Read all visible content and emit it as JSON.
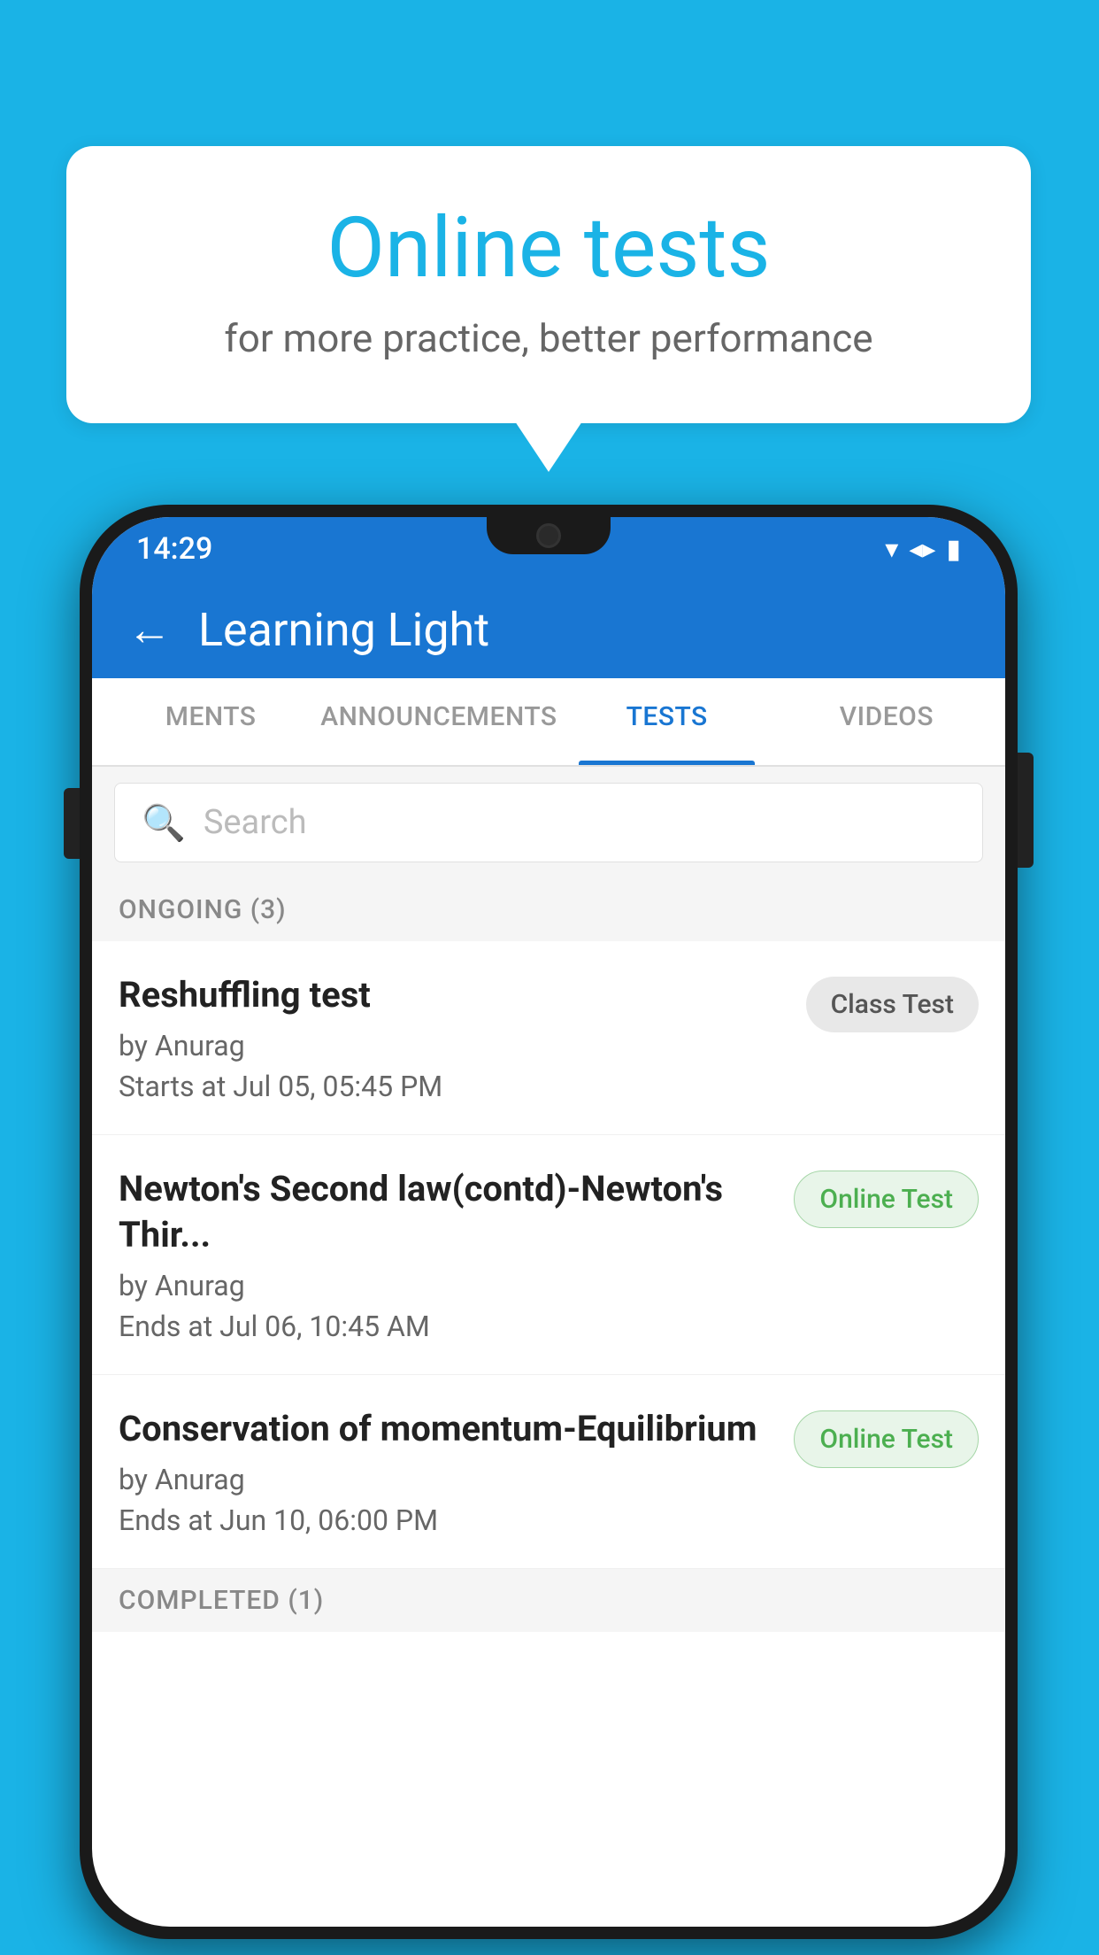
{
  "background_color": "#1ab3e6",
  "bubble": {
    "title": "Online tests",
    "subtitle": "for more practice, better performance"
  },
  "phone": {
    "status_bar": {
      "time": "14:29",
      "icons": [
        "▼",
        "◀",
        "▮"
      ]
    },
    "app_bar": {
      "title": "Learning Light",
      "back_label": "←"
    },
    "tabs": [
      {
        "label": "MENTS",
        "active": false
      },
      {
        "label": "ANNOUNCEMENTS",
        "active": false
      },
      {
        "label": "TESTS",
        "active": true
      },
      {
        "label": "VIDEOS",
        "active": false
      }
    ],
    "search": {
      "placeholder": "Search"
    },
    "section_ongoing": "ONGOING (3)",
    "tests": [
      {
        "name": "Reshuffling test",
        "author": "by Anurag",
        "date": "Starts at  Jul 05, 05:45 PM",
        "badge": "Class Test",
        "badge_type": "class"
      },
      {
        "name": "Newton's Second law(contd)-Newton's Thir...",
        "author": "by Anurag",
        "date": "Ends at  Jul 06, 10:45 AM",
        "badge": "Online Test",
        "badge_type": "online"
      },
      {
        "name": "Conservation of momentum-Equilibrium",
        "author": "by Anurag",
        "date": "Ends at  Jun 10, 06:00 PM",
        "badge": "Online Test",
        "badge_type": "online"
      }
    ],
    "section_completed": "COMPLETED (1)"
  }
}
